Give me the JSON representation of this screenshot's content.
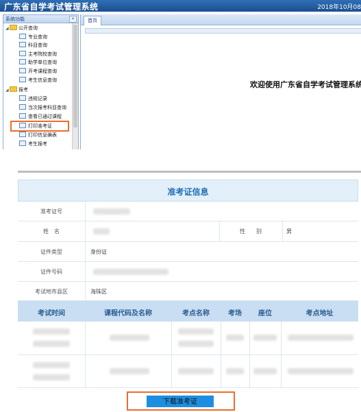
{
  "top": {
    "app_title": "广东省自学考试管理系统",
    "datetime": "2018年10月08",
    "sidebar": {
      "title": "系统功能",
      "collapse_icon": "«",
      "groups": [
        {
          "label": "公开查询",
          "toggle": "◢",
          "items": [
            "专业查询",
            "科目查询",
            "主考院校查询",
            "助学单位查询",
            "开考课程查询",
            "考生信息查询"
          ]
        },
        {
          "label": "报考",
          "toggle": "◢",
          "items": [
            "违规记录",
            "当次报考科目查询",
            "查看已通过课程",
            "打印准考证",
            "打印信息确表",
            "考生报考"
          ]
        }
      ]
    },
    "tab_home": "首页",
    "welcome": "欢迎使用广东省自学考试管理系统"
  },
  "ticket": {
    "title": "准考证信息",
    "fields": {
      "ticket_no_label": "准考证号",
      "name_label": "姓　名",
      "gender_label": "性　　别",
      "gender_value": "男",
      "id_type_label": "证件类型",
      "id_type_value": "身份证",
      "id_no_label": "证件号码",
      "exam_area_label": "考试地市县区",
      "exam_area_value": "海珠区"
    },
    "table_headers": [
      "考试时间",
      "课程代码及名称",
      "考点名称",
      "考场",
      "座位",
      "考点地址"
    ],
    "download_label": "下载准考证"
  },
  "colors": {
    "title_blue": "#1f6fb6",
    "header_bg": "#c9def2",
    "highlight": "#ef6b2a",
    "button_blue": "#1e8fe0"
  }
}
